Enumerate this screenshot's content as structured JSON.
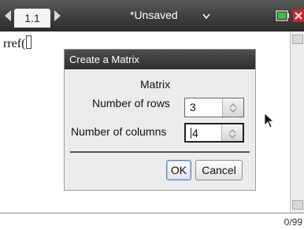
{
  "app": {
    "tab_label": "1.1",
    "document_title": "*Unsaved",
    "accent_red": "#c8262c",
    "battery_green": "#3cbf3c"
  },
  "workspace": {
    "command_text": "rref("
  },
  "dialog": {
    "title": "Create a Matrix",
    "section_label": "Matrix",
    "rows_label": "Number of rows",
    "rows_value": "3",
    "columns_label": "Number of columns",
    "columns_value": "4",
    "ok_label": "OK",
    "cancel_label": "Cancel"
  },
  "status": {
    "char_count": "0/99"
  }
}
